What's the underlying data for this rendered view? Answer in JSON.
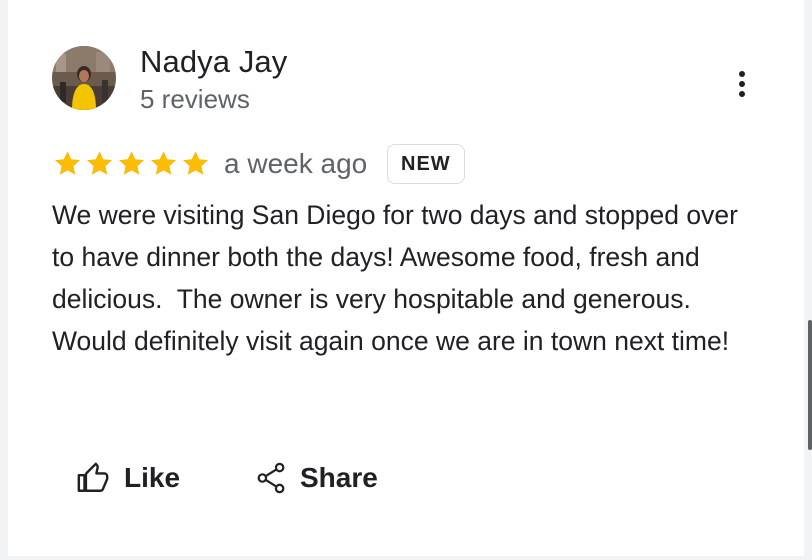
{
  "reviewer": {
    "name": "Nadya Jay",
    "review_count": "5 reviews"
  },
  "review": {
    "rating": 5,
    "max_rating": 5,
    "time_ago": "a week ago",
    "badge": "NEW",
    "text": "We were visiting San Diego for two days and stopped over to have dinner both the days! Awesome food, fresh and delicious.  The owner is very hospitable and generous. Would definitely visit again once we are in town next time!"
  },
  "actions": {
    "like_label": "Like",
    "share_label": "Share"
  },
  "icons": {
    "more": "more-vert-icon",
    "like": "thumb-up-icon",
    "share": "share-icon",
    "star": "star-icon"
  },
  "colors": {
    "star": "#fbbc04",
    "text": "#202124",
    "secondary_text": "#5f6368",
    "badge_border": "#dadce0"
  }
}
